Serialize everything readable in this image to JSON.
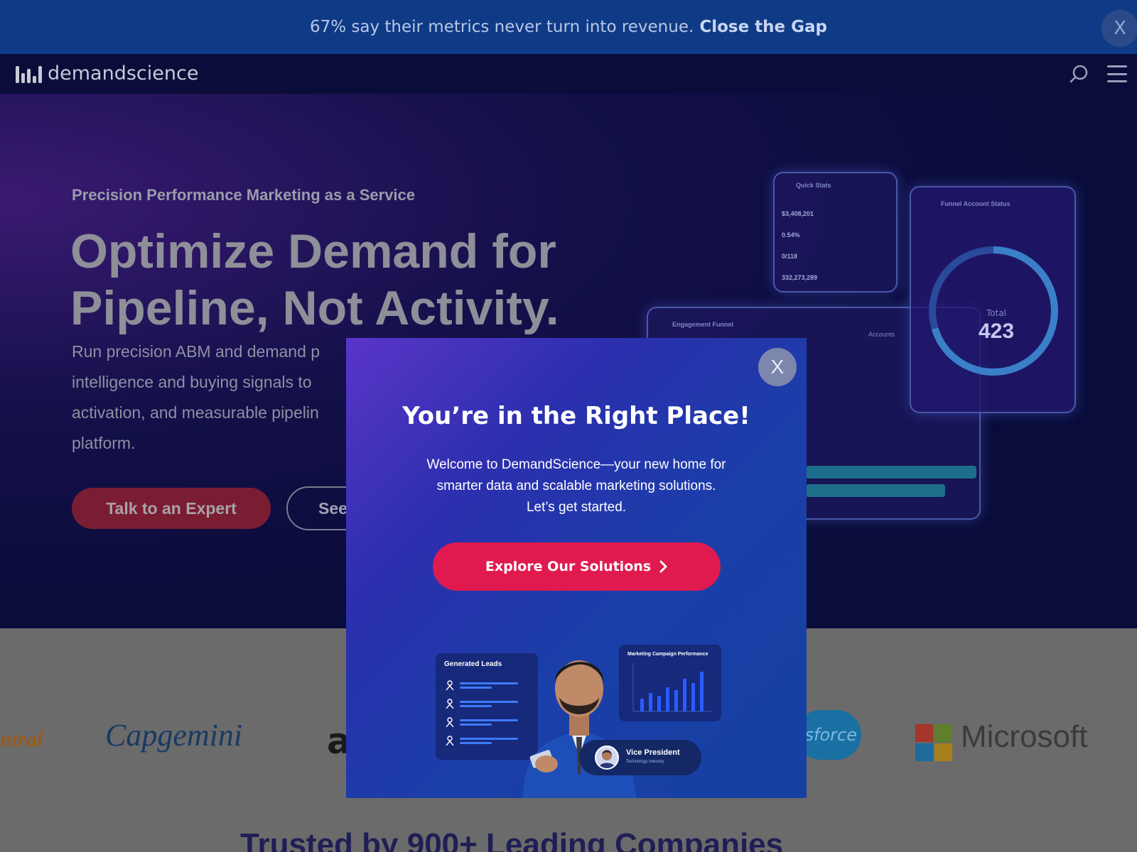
{
  "announcement": {
    "text": "67% say their metrics never turn into revenue.",
    "link": "Close the Gap",
    "close_label": "X"
  },
  "header": {
    "logo_text": "demandscience",
    "icons": [
      "search-icon",
      "menu-icon"
    ]
  },
  "hero": {
    "eyebrow": "Precision Performance Marketing as a Service",
    "headline_line1": "Optimize Demand for",
    "headline_line2": "Pipeline, Not Activity.",
    "body_lines": [
      "Run precision ABM and demand p",
      "intelligence and buying signals to",
      "activation, and measurable pipelin",
      "platform."
    ],
    "primary_button": "Talk to an Expert",
    "secondary_button": "See"
  },
  "dashboard": {
    "quick_stats_title": "Quick Stats",
    "quick_stats": [
      {
        "value": "$3,408,201"
      },
      {
        "value": "0.54%"
      },
      {
        "value": "0/118"
      },
      {
        "value": "332,273,289"
      }
    ],
    "funnel_title": "Funnel Account Status",
    "funnel_total_label": "Total",
    "funnel_total": "423",
    "engagement_title": "Engagement Funnel",
    "engagement_tag": "Accounts"
  },
  "logos": {
    "items": [
      "ntral",
      "Capgemini",
      "a",
      "sforce",
      "Microsoft"
    ],
    "trusted_heading": "Trusted by 900+ Leading Companies"
  },
  "modal": {
    "close_label": "X",
    "title": "You’re in the Right Place!",
    "body_line1": "Welcome to DemandScience—your new home for",
    "body_line2": "smarter data and scalable marketing solutions.",
    "body_line3": "Let’s get started.",
    "cta": "Explore Our Solutions",
    "leads_card_title": "Generated Leads",
    "perf_card_title": "Marketing Campaign Performance",
    "badge_title": "Vice President",
    "badge_sub": "Technology Industry"
  },
  "colors": {
    "announcement_bg": "#0f3b86",
    "cta_red": "#e01a4f",
    "modal_gradient_start": "#5a35c8",
    "modal_gradient_end": "#1640a2"
  }
}
